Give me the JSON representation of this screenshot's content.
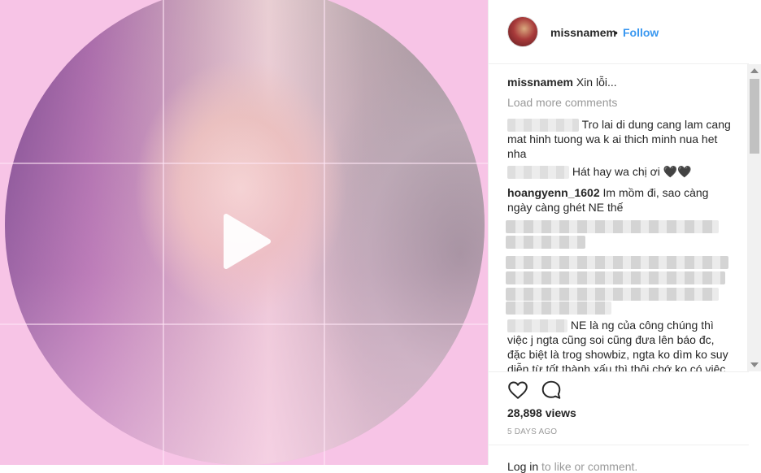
{
  "post": {
    "username": "missnamem",
    "separator": "•",
    "follow_label": "Follow",
    "caption_username": "missnamem",
    "caption_text": "Xin lỗi...",
    "load_more": "Load more comments",
    "views": "28,898 views",
    "date": "5 DAYS AGO",
    "login_link": "Log in",
    "login_rest": "to like or comment."
  },
  "comments": [
    {
      "username": "",
      "text": "Tro lai di dung cang lam cang mat hinh tuong wa k ai thich minh nua het nha"
    },
    {
      "username": "",
      "text": "Hát hay wa chị ơi 🖤🖤"
    },
    {
      "username": "hoangyenn_1602",
      "text": "Im mồm đi, sao càng ngày càng ghét NE thế"
    },
    {
      "username": "",
      "text": "NE là ng của công chúng thì việc j ngta cũng soi cũng đưa lên báo đc, đặc biệt là trog showbiz, ngta ko dìm ko suy diễn từ tốt thành xấu thì thôi chớ ko có việc ngta"
    }
  ],
  "icons": {
    "play": "play-icon",
    "like": "heart-icon",
    "comment": "comment-icon"
  },
  "colors": {
    "link": "#3897f0",
    "background": "#f7c4e6"
  }
}
